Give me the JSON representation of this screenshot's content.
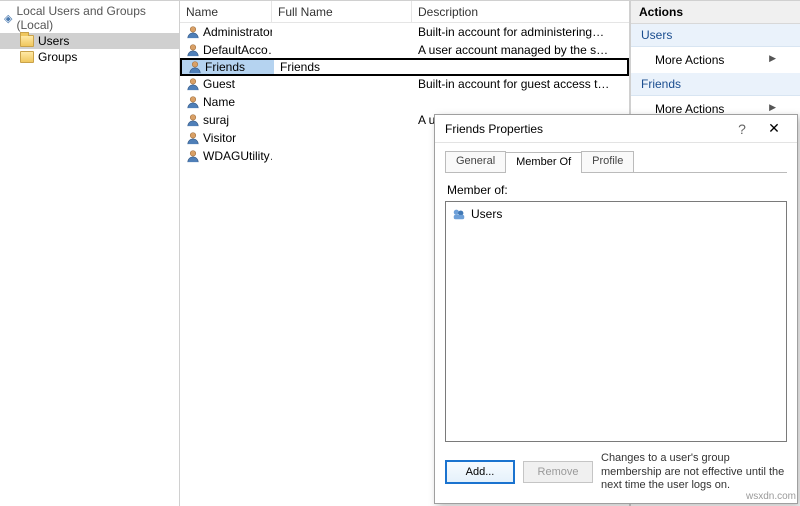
{
  "tree": {
    "root_label": "Local Users and Groups (Local)",
    "items": [
      {
        "label": "Users",
        "selected": true
      },
      {
        "label": "Groups",
        "selected": false
      }
    ]
  },
  "columns": {
    "name": "Name",
    "fullname": "Full Name",
    "description": "Description"
  },
  "users": [
    {
      "name": "Administrator",
      "fullname": "",
      "description": "Built-in account for administering…",
      "selected": false
    },
    {
      "name": "DefaultAcco…",
      "fullname": "",
      "description": "A user account managed by the s…",
      "selected": false
    },
    {
      "name": "Friends",
      "fullname": "Friends",
      "description": "",
      "selected": true
    },
    {
      "name": "Guest",
      "fullname": "",
      "description": "Built-in account for guest access t…",
      "selected": false
    },
    {
      "name": "Name",
      "fullname": "",
      "description": "",
      "selected": false
    },
    {
      "name": "suraj",
      "fullname": "",
      "description": "A u",
      "selected": false
    },
    {
      "name": "Visitor",
      "fullname": "",
      "description": "",
      "selected": false
    },
    {
      "name": "WDAGUtility…",
      "fullname": "",
      "description": "",
      "selected": false
    }
  ],
  "actions": {
    "header": "Actions",
    "sections": [
      {
        "title": "Users",
        "items": [
          "More Actions"
        ]
      },
      {
        "title": "Friends",
        "items": [
          "More Actions"
        ]
      }
    ]
  },
  "dialog": {
    "title": "Friends Properties",
    "help": "?",
    "close": "✕",
    "tabs": [
      "General",
      "Member Of",
      "Profile"
    ],
    "active_tab": 1,
    "member_of_label": "Member of:",
    "members": [
      "Users"
    ],
    "add_button": "Add...",
    "remove_button": "Remove",
    "hint": "Changes to a user's group membership are not effective until the next time the user logs on."
  },
  "watermark": "wsxdn.com"
}
